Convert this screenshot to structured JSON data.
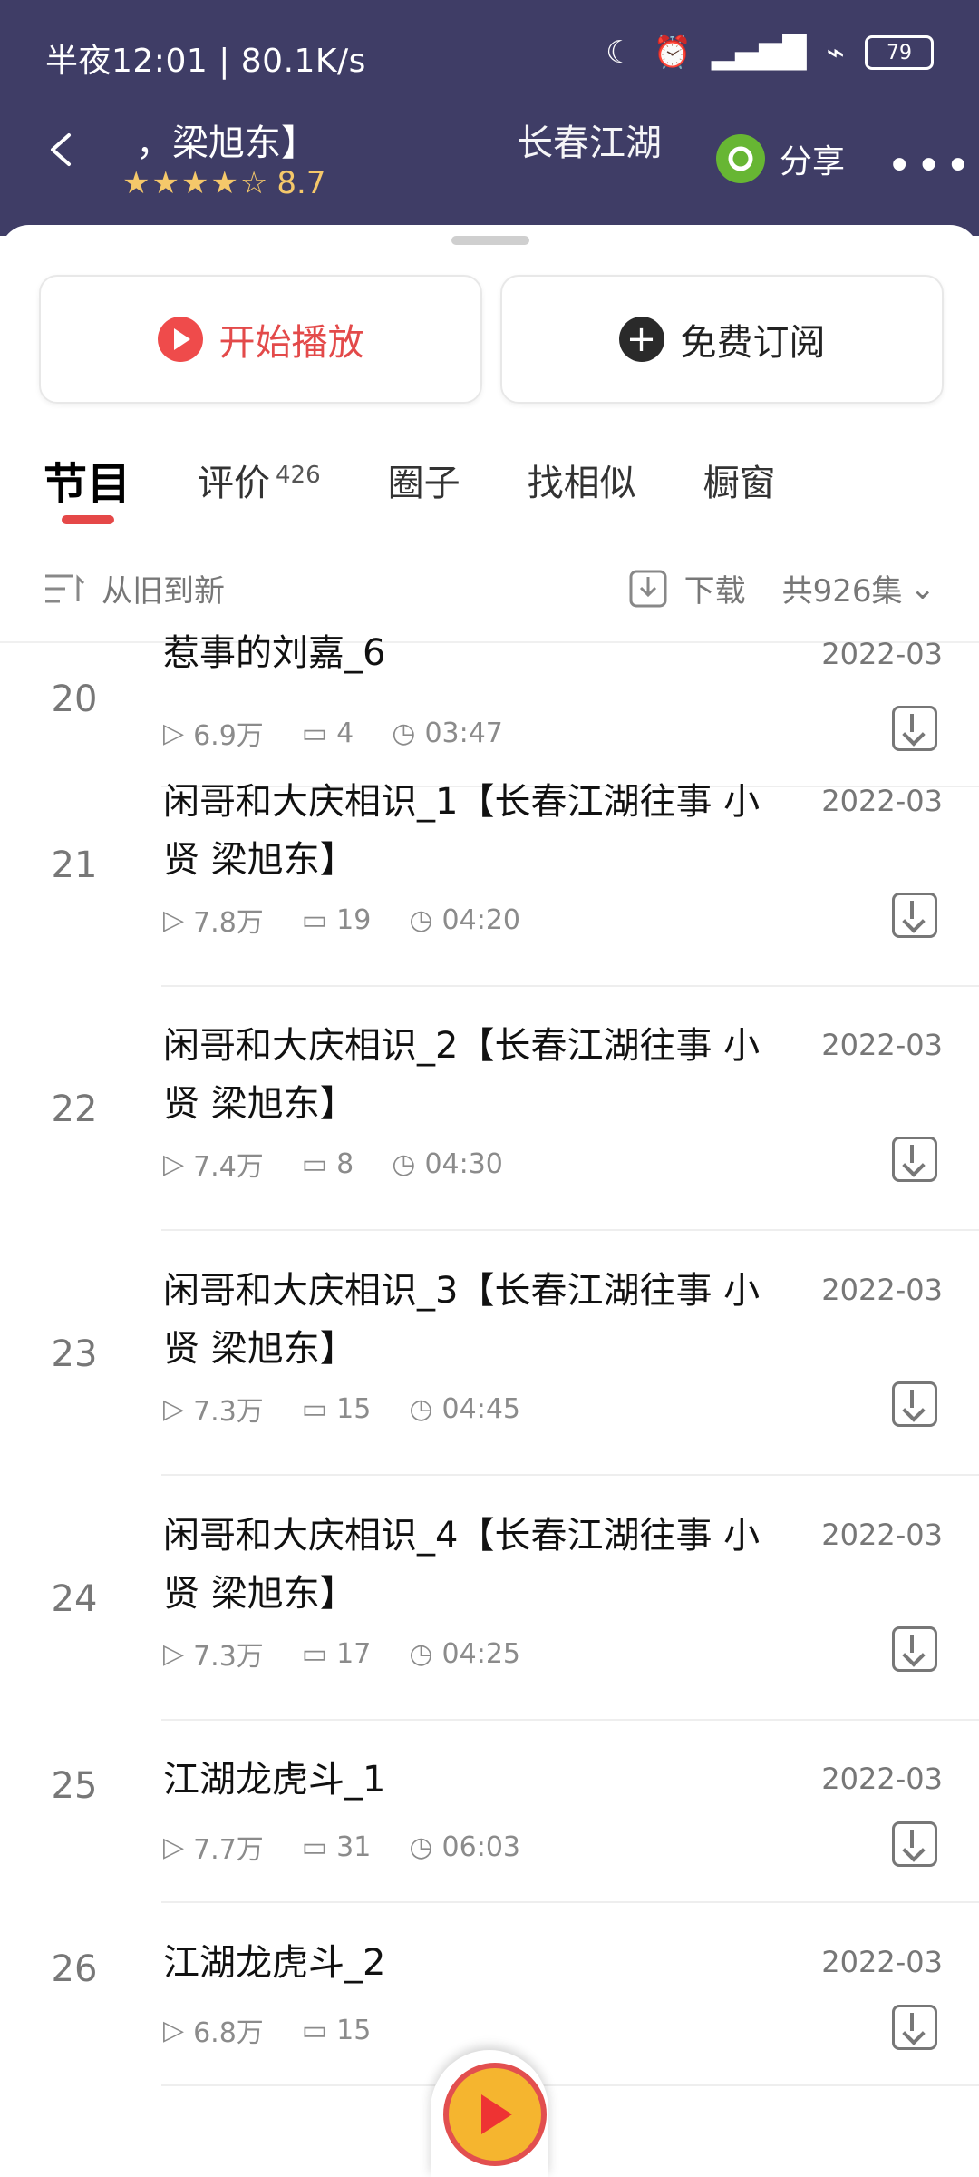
{
  "status_bar": {
    "time": "半夜12:01 | 80.1K/s",
    "battery": "79"
  },
  "header": {
    "title_fragment_left": "，梁旭东】",
    "rating": "8.7",
    "stars": "★★★★☆",
    "title_fragment_right": "长春江湖",
    "share_label": "分享"
  },
  "actions": {
    "play_label": "开始播放",
    "subscribe_label": "免费订阅"
  },
  "tabs": [
    {
      "label": "节目"
    },
    {
      "label": "评价",
      "badge": "426"
    },
    {
      "label": "圈子"
    },
    {
      "label": "找相似"
    },
    {
      "label": "橱窗"
    }
  ],
  "filter": {
    "sort_label": "从旧到新",
    "download_label": "下载",
    "count_label": "共926集"
  },
  "episodes": [
    {
      "num": "20",
      "title": "惹事的刘嘉_6",
      "date": "2022-03",
      "plays": "6.9万",
      "comments": "4",
      "duration": "03:47"
    },
    {
      "num": "21",
      "title": "闲哥和大庆相识_1【长春江湖往事 小贤 梁旭东】",
      "date": "2022-03",
      "plays": "7.8万",
      "comments": "19",
      "duration": "04:20"
    },
    {
      "num": "22",
      "title": "闲哥和大庆相识_2【长春江湖往事 小贤 梁旭东】",
      "date": "2022-03",
      "plays": "7.4万",
      "comments": "8",
      "duration": "04:30"
    },
    {
      "num": "23",
      "title": "闲哥和大庆相识_3【长春江湖往事 小贤 梁旭东】",
      "date": "2022-03",
      "plays": "7.3万",
      "comments": "15",
      "duration": "04:45"
    },
    {
      "num": "24",
      "title": "闲哥和大庆相识_4【长春江湖往事 小贤 梁旭东】",
      "date": "2022-03",
      "plays": "7.3万",
      "comments": "17",
      "duration": "04:25"
    },
    {
      "num": "25",
      "title": "江湖龙虎斗_1",
      "date": "2022-03",
      "plays": "7.7万",
      "comments": "31",
      "duration": "06:03"
    },
    {
      "num": "26",
      "title": "江湖龙虎斗_2",
      "date": "2022-03",
      "plays": "6.8万",
      "comments": "15",
      "duration": ""
    }
  ]
}
